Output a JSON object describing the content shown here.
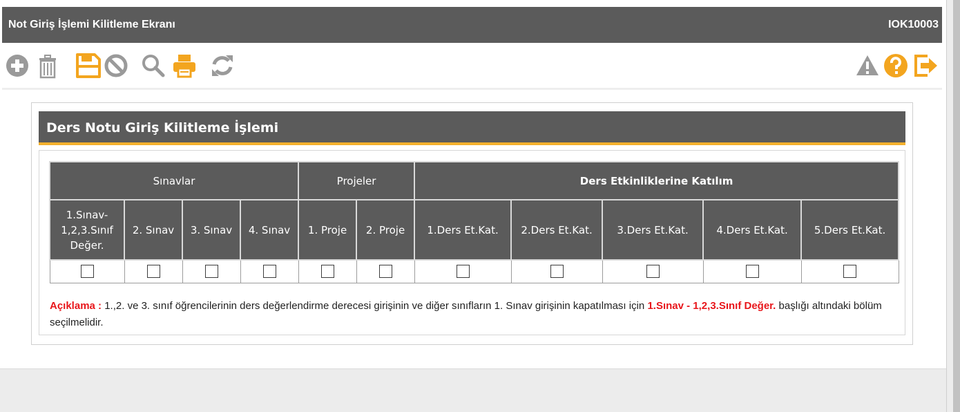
{
  "window": {
    "title": "Not Giriş İşlemi Kilitleme Ekranı",
    "code": "IOK10003"
  },
  "toolbar": {
    "left": [
      {
        "name": "add-icon",
        "color": "#9a9a9a"
      },
      {
        "name": "trash-icon",
        "color": "#9a9a9a"
      },
      {
        "name": "save-icon",
        "color": "#f3a51f"
      },
      {
        "name": "cancel-icon",
        "color": "#9a9a9a"
      },
      {
        "name": "search-icon",
        "color": "#9a9a9a"
      },
      {
        "name": "print-icon",
        "color": "#f3a51f"
      },
      {
        "name": "refresh-icon",
        "color": "#9a9a9a"
      }
    ],
    "right": [
      {
        "name": "warning-icon",
        "color": "#9a9a9a"
      },
      {
        "name": "help-icon",
        "color": "#f3a51f"
      },
      {
        "name": "exit-icon",
        "color": "#f3a51f"
      }
    ]
  },
  "panel": {
    "title": "Ders Notu Giriş Kilitleme İşlemi"
  },
  "table": {
    "groups": [
      "Sınavlar",
      "Projeler",
      "Ders Etkinliklerine Katılım"
    ],
    "columns": [
      "1.Sınav-1,2,3.Sınıf Değer.",
      "2. Sınav",
      "3. Sınav",
      "4. Sınav",
      "1. Proje",
      "2. Proje",
      "1.Ders Et.Kat.",
      "2.Ders Et.Kat.",
      "3.Ders Et.Kat.",
      "4.Ders Et.Kat.",
      "5.Ders Et.Kat."
    ],
    "checked": [
      false,
      false,
      false,
      false,
      false,
      false,
      false,
      false,
      false,
      false,
      false
    ]
  },
  "note": {
    "label": "Açıklama :",
    "text_before": "1.,2. ve 3. sınıf öğrencilerinin ders değerlendirme derecesi girişinin ve diğer sınıfların 1. Sınav girişinin kapatılması için",
    "highlight": "1.Sınav - 1,2,3.Sınıf Değer.",
    "text_after": "başlığı altındaki bölüm seçilmelidir."
  },
  "colors": {
    "header_bg": "#5b5b5b",
    "accent": "#f3b02d",
    "note_red": "#e8161b"
  }
}
